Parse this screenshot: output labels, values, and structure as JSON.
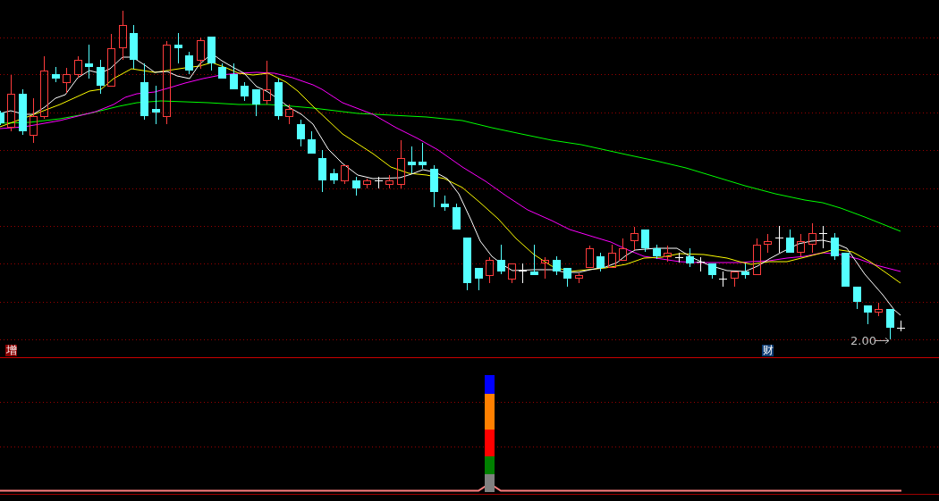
{
  "price_chart": {
    "event_badges": [
      {
        "label": "增",
        "color": "#8b0000"
      },
      {
        "label": "财",
        "color": "#0b3b73"
      }
    ],
    "low_price_label": "2.00"
  }
}
